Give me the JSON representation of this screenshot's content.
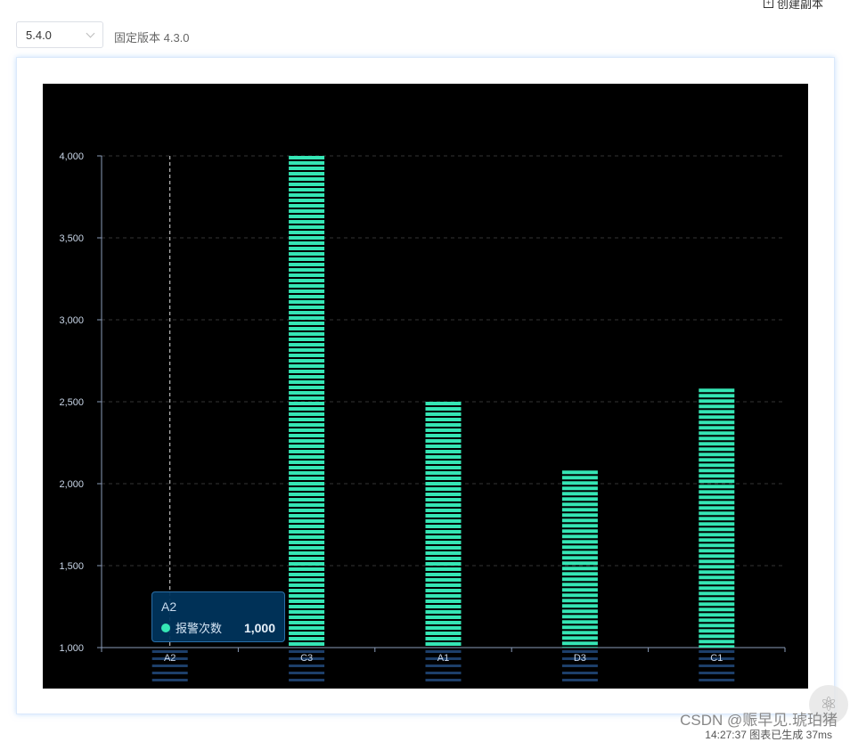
{
  "header": {
    "create_copy_label": "创建副本",
    "version_value": "5.4.0",
    "fixed_version_label": "固定版本 4.3.0"
  },
  "chart_data": {
    "type": "bar",
    "categories": [
      "A2",
      "C3",
      "A1",
      "D3",
      "C1"
    ],
    "series": [
      {
        "name": "报警次数",
        "values": [
          1000,
          4000,
          2500,
          2080,
          2580
        ],
        "color": "#35e6b5"
      }
    ],
    "ylim": [
      1000,
      4000
    ],
    "yticks": [
      1000,
      1500,
      2000,
      2500,
      3000,
      3500,
      4000
    ],
    "ytick_labels": [
      "1,000",
      "1,500",
      "2,000",
      "2,500",
      "3,000",
      "3,500",
      "4,000"
    ],
    "grid": true,
    "background": "#000000",
    "reflection_color": "#1d3f6a"
  },
  "tooltip": {
    "title": "A2",
    "series_name": "报警次数",
    "value": "1,000"
  },
  "watermark": "CSDN @赈早见.琥珀猪",
  "footer_time": "14:27:37 图表已生成 37ms"
}
